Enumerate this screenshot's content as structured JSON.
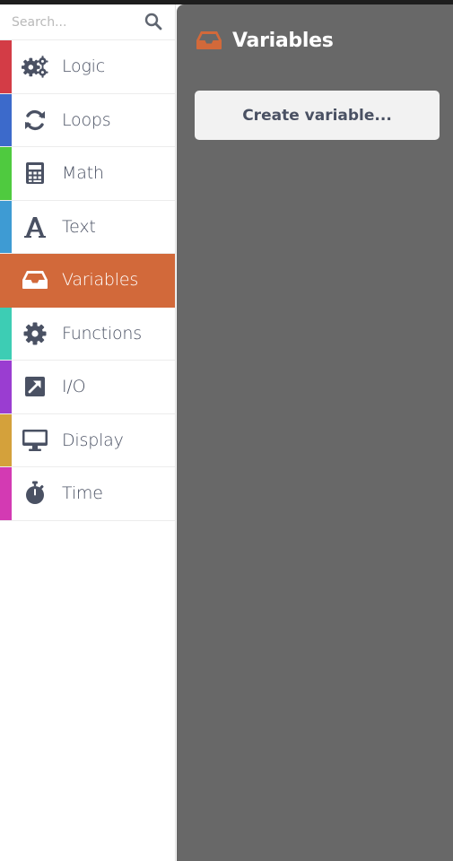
{
  "search": {
    "placeholder": "Search...",
    "icon": "search-icon"
  },
  "categories": [
    {
      "label": "Logic",
      "color": "#d33c46",
      "icon": "gears-icon"
    },
    {
      "label": "Loops",
      "color": "#3c6acb",
      "icon": "refresh-icon"
    },
    {
      "label": "Math",
      "color": "#4fca3f",
      "icon": "calculator-icon"
    },
    {
      "label": "Text",
      "color": "#3e9bd3",
      "icon": "font-icon"
    },
    {
      "label": "Variables",
      "color": "#d2693a",
      "icon": "inbox-icon",
      "active": true
    },
    {
      "label": "Functions",
      "color": "#3dcdb4",
      "icon": "gear-icon"
    },
    {
      "label": "I/O",
      "color": "#9a3dd1",
      "icon": "external-link-icon"
    },
    {
      "label": "Display",
      "color": "#d4a13b",
      "icon": "desktop-icon"
    },
    {
      "label": "Time",
      "color": "#d33ab3",
      "icon": "stopwatch-icon"
    }
  ],
  "flyout": {
    "title": "Variables",
    "icon": "inbox-icon",
    "accent": "#d2693a",
    "background": "#686868",
    "create_button": "Create variable..."
  },
  "colors": {
    "icon": "#4a5163",
    "active_text": "#ffffff"
  }
}
